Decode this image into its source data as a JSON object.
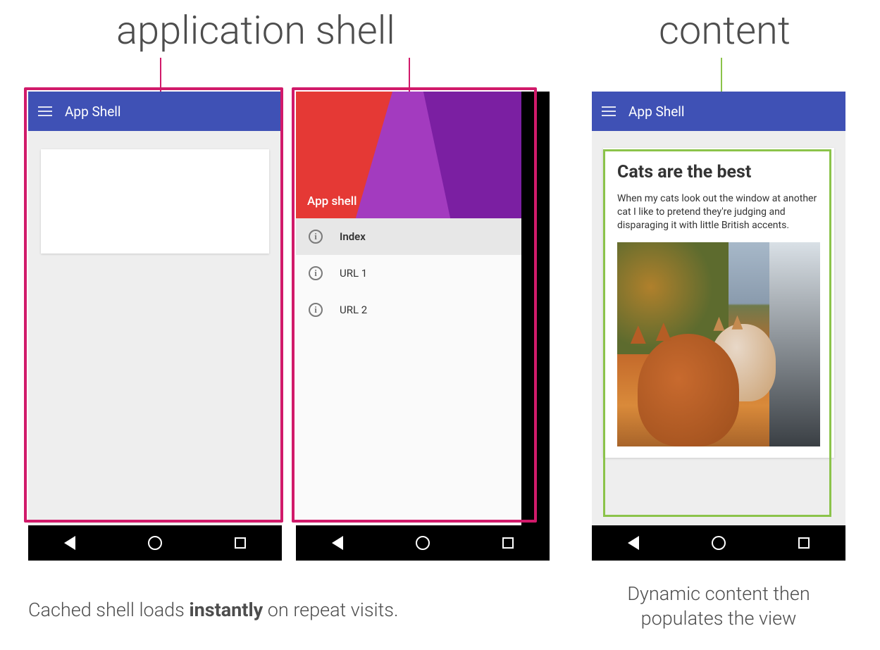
{
  "labels": {
    "shell": "application shell",
    "content": "content"
  },
  "appbar": {
    "title": "App Shell"
  },
  "drawer": {
    "headerTitle": "App shell",
    "items": [
      {
        "label": "Index",
        "active": true
      },
      {
        "label": "URL 1",
        "active": false
      },
      {
        "label": "URL 2",
        "active": false
      }
    ]
  },
  "article": {
    "title": "Cats are the best",
    "body": "When my cats look out the window at another cat I like to pretend they're judging and disparaging it with little British accents."
  },
  "captions": {
    "shell_pre": "Cached shell loads ",
    "shell_bold": "instantly",
    "shell_post": " on repeat visits.",
    "content": "Dynamic content then populates the view"
  },
  "colors": {
    "outline_shell": "#d11a6a",
    "outline_content": "#8bc34a",
    "appbar": "#3f51b5"
  }
}
